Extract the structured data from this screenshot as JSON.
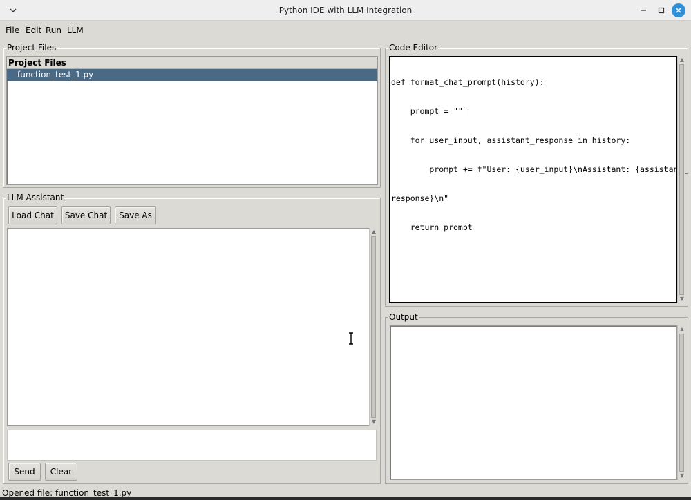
{
  "window": {
    "title": "Python IDE with LLM Integration"
  },
  "menu": [
    "File",
    "Edit",
    "Run",
    "LLM"
  ],
  "project_files": {
    "frame_label": "Project Files",
    "header": "Project Files",
    "items": [
      {
        "name": "function_test_1.py",
        "selected": true
      }
    ]
  },
  "llm_assistant": {
    "frame_label": "LLM Assistant",
    "buttons": {
      "load": "Load Chat",
      "save": "Save Chat",
      "save_as": "Save As"
    },
    "chat_text": "",
    "input_value": "",
    "send_label": "Send",
    "clear_label": "Clear"
  },
  "code_editor": {
    "frame_label": "Code Editor",
    "lines": [
      "def format_chat_prompt(history):",
      "    prompt = \"\"",
      "    for user_input, assistant_response in history:",
      "        prompt += f\"User: {user_input}\\nAssistant: {assistant_",
      "response}\\n\"",
      "    return prompt"
    ]
  },
  "output": {
    "frame_label": "Output",
    "text": ""
  },
  "status": {
    "text": "Opened file: function_test_1.py"
  },
  "colors": {
    "background": "#dcdad5",
    "selection": "#4a6984",
    "close_button": "#2f8fd8"
  }
}
